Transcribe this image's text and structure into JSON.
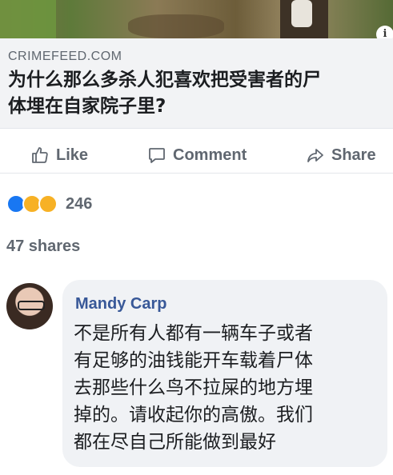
{
  "link_preview": {
    "domain": "CRIMEFEED.COM",
    "headline_lines": [
      "为什么那么多杀人犯喜欢把受害者的尸",
      "体埋在自家院子里?"
    ],
    "info_badge": "i"
  },
  "actions": {
    "like": "Like",
    "comment": "Comment",
    "share": "Share"
  },
  "reactions": {
    "icons": [
      "like-icon",
      "wow-icon",
      "sad-icon"
    ],
    "count": "246"
  },
  "shares_text": "47 shares",
  "comment": {
    "author": "Mandy Carp",
    "lines": [
      "不是所有人都有一辆车子或者",
      "有足够的油钱能开车载着尸体",
      "去那些什么鸟不拉屎的地方埋",
      "掉的。请收起你的高傲。我们",
      "都在尽自己所能做到最好"
    ]
  },
  "colors": {
    "link_blue": "#385898",
    "like_blue": "#1877f2",
    "muted": "#606770",
    "bubble_bg": "#f0f2f5"
  }
}
